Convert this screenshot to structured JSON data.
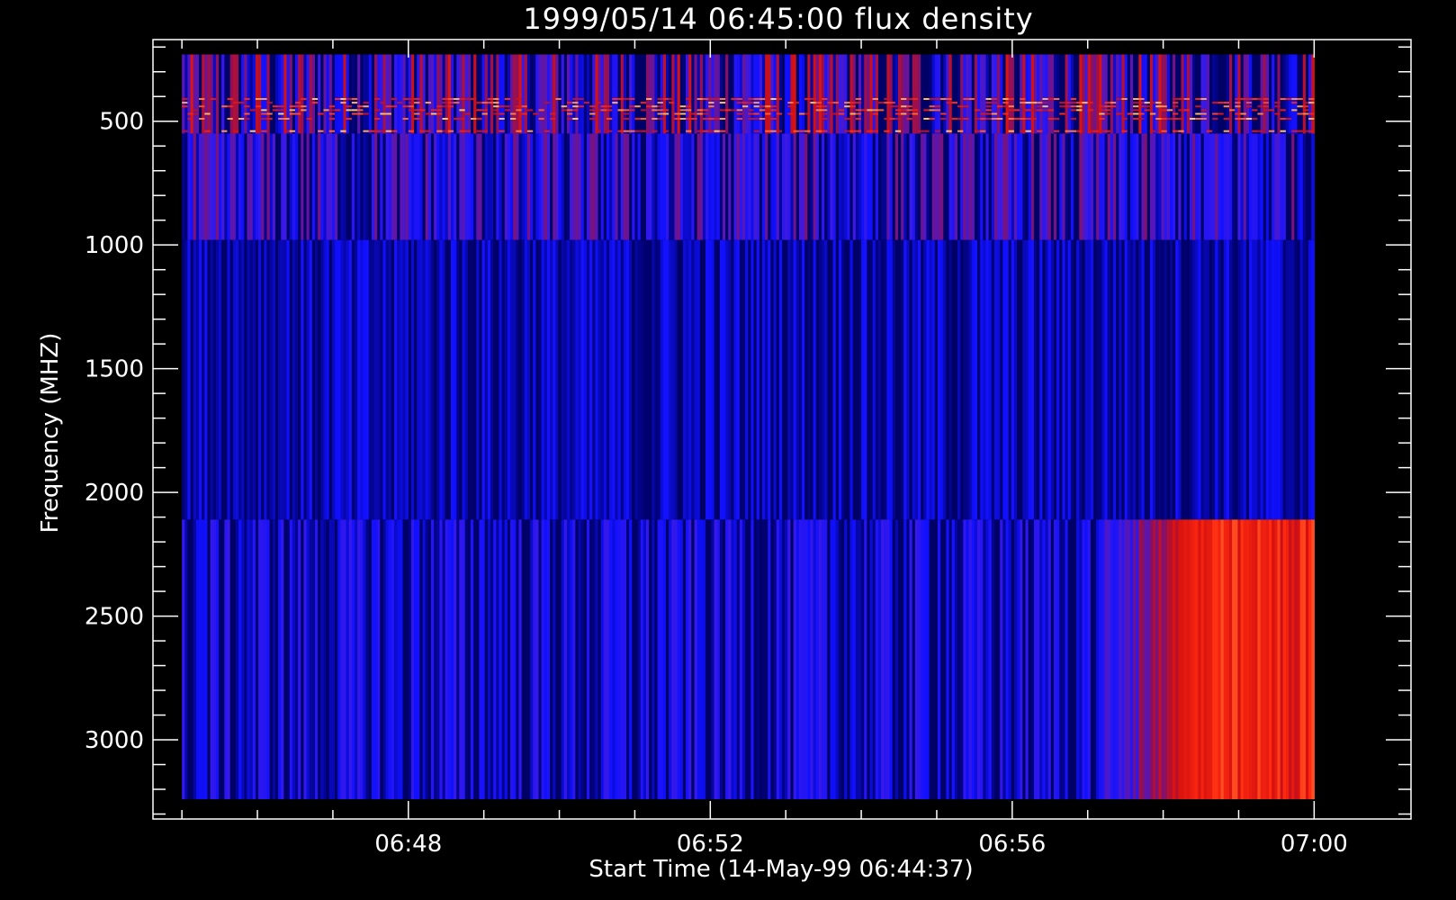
{
  "chart_data": {
    "type": "heatmap",
    "title": "1999/05/14 06:45:00 flux density",
    "xlabel": "Start Time (14-May-99 06:44:37)",
    "ylabel": "Frequency (MHZ)",
    "x_ticks": [
      "06:48",
      "06:52",
      "06:56",
      "07:00"
    ],
    "y_ticks": [
      500,
      1000,
      1500,
      2000,
      2500,
      3000
    ],
    "x_range": [
      "06:44:37",
      "07:01:17"
    ],
    "x_data_range": [
      "06:45:00",
      "07:00:00"
    ],
    "ylim": [
      3320,
      170
    ],
    "y_data_range": [
      3240,
      230
    ],
    "y_reversed": true,
    "colormap": [
      "#000066",
      "#1010ff",
      "#3a1ae6",
      "#8a1060",
      "#d41010",
      "#ff2a10",
      "#ffd060"
    ],
    "bands": [
      {
        "freq_range": [
          230,
          550
        ],
        "description_intensity": "narrowband emission lines",
        "mean_intensity": 0.25,
        "variability": 0.45
      },
      {
        "freq_range": [
          550,
          980
        ],
        "mean_intensity": 0.18,
        "variability": 0.3
      },
      {
        "freq_range": [
          980,
          2110
        ],
        "mean_intensity": 0.08,
        "variability": 0.12
      },
      {
        "freq_range": [
          2110,
          3240
        ],
        "mean_intensity": 0.12,
        "variability": 0.2,
        "enhanced_after": "06:57:00",
        "enhanced_intensity": 0.75
      }
    ],
    "grid": false
  }
}
